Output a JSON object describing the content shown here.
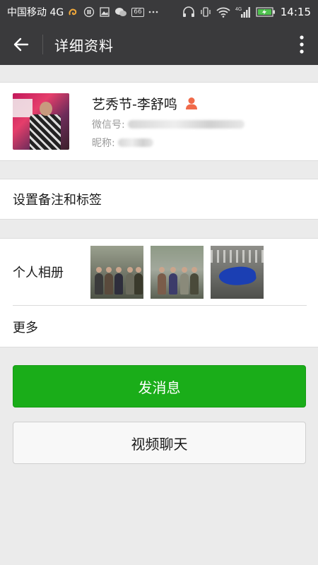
{
  "status_bar": {
    "carrier": "中国移动 4G",
    "badge": "66",
    "network": "4G",
    "time": "14:15"
  },
  "header": {
    "title": "详细资料"
  },
  "profile": {
    "name": "艺秀节-李舒鸣",
    "wechat_id_label": "微信号:",
    "nickname_label": "昵称:"
  },
  "remark": {
    "label": "设置备注和标签"
  },
  "album": {
    "label": "个人相册"
  },
  "more": {
    "label": "更多"
  },
  "actions": {
    "send_message": "发消息",
    "video_chat": "视频聊天"
  },
  "colors": {
    "bar": "#3a3a3c",
    "primary_green": "#1aad19",
    "background": "#ebebeb",
    "gender_icon": "#f06a4a"
  }
}
